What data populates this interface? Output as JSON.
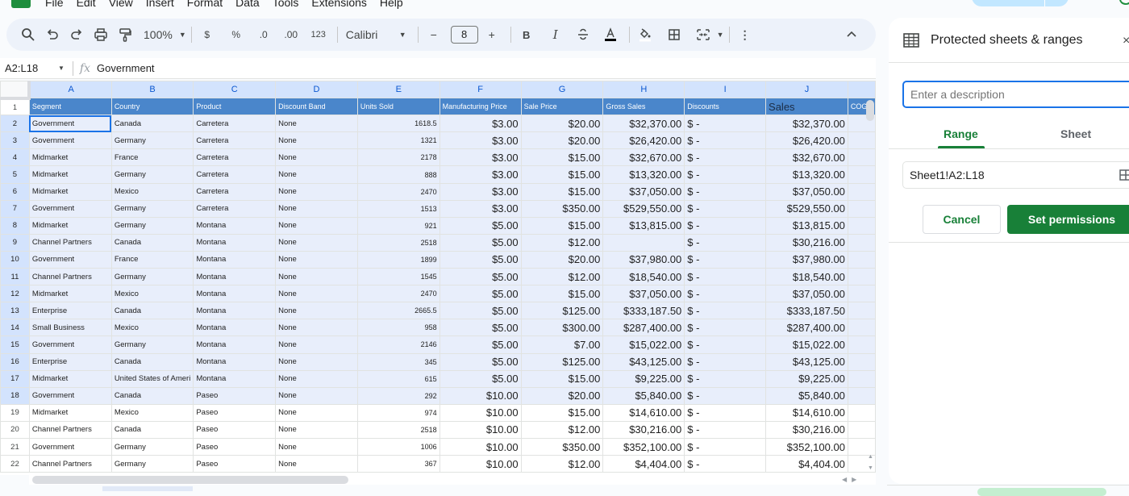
{
  "menubar": {
    "items": [
      "File",
      "Edit",
      "View",
      "Insert",
      "Format",
      "Data",
      "Tools",
      "Extensions",
      "Help"
    ]
  },
  "toolbar": {
    "zoom": "100%",
    "currency": "$",
    "percent": "%",
    "decrease_decimal": ".0",
    "increase_decimal": ".00",
    "number_format": "123",
    "font": "Calibri",
    "font_size": "8",
    "minus": "−",
    "plus": "+",
    "bold": "B",
    "italic": "I",
    "more": "⋮",
    "collapse": "^"
  },
  "formula_bar": {
    "name_box": "A2:L18",
    "fx": "fx",
    "formula": "Government"
  },
  "grid": {
    "columns": [
      "A",
      "B",
      "C",
      "D",
      "E",
      "F",
      "G",
      "H",
      "I",
      "J",
      ""
    ],
    "header_row": [
      "Segment",
      "Country",
      "Product",
      "Discount Band",
      "Units Sold",
      "Manufacturing Price",
      "Sale Price",
      "Gross Sales",
      "Discounts",
      "Sales",
      "COGS"
    ],
    "selected_rows_range": [
      2,
      18
    ],
    "rows": [
      {
        "n": "2",
        "cells": [
          "Government",
          "Canada",
          "Carretera",
          "None",
          "1618.5",
          "$3.00",
          "$20.00",
          "$32,370.00",
          "$ -",
          "$32,370.00"
        ]
      },
      {
        "n": "3",
        "cells": [
          "Government",
          "Germany",
          "Carretera",
          "None",
          "1321",
          "$3.00",
          "$20.00",
          "$26,420.00",
          "$ -",
          "$26,420.00"
        ]
      },
      {
        "n": "4",
        "cells": [
          "Midmarket",
          "France",
          "Carretera",
          "None",
          "2178",
          "$3.00",
          "$15.00",
          "$32,670.00",
          "$ -",
          "$32,670.00"
        ]
      },
      {
        "n": "5",
        "cells": [
          "Midmarket",
          "Germany",
          "Carretera",
          "None",
          "888",
          "$3.00",
          "$15.00",
          "$13,320.00",
          "$ -",
          "$13,320.00"
        ]
      },
      {
        "n": "6",
        "cells": [
          "Midmarket",
          "Mexico",
          "Carretera",
          "None",
          "2470",
          "$3.00",
          "$15.00",
          "$37,050.00",
          "$ -",
          "$37,050.00"
        ]
      },
      {
        "n": "7",
        "cells": [
          "Government",
          "Germany",
          "Carretera",
          "None",
          "1513",
          "$3.00",
          "$350.00",
          "$529,550.00",
          "$ -",
          "$529,550.00"
        ]
      },
      {
        "n": "8",
        "cells": [
          "Midmarket",
          "Germany",
          "Montana",
          "None",
          "921",
          "$5.00",
          "$15.00",
          "$13,815.00",
          "$ -",
          "$13,815.00"
        ]
      },
      {
        "n": "9",
        "cells": [
          "Channel Partners",
          "Canada",
          "Montana",
          "None",
          "2518",
          "$5.00",
          "$12.00",
          "",
          "$ -",
          "$30,216.00"
        ]
      },
      {
        "n": "10",
        "cells": [
          "Government",
          "France",
          "Montana",
          "None",
          "1899",
          "$5.00",
          "$20.00",
          "$37,980.00",
          "$ -",
          "$37,980.00"
        ]
      },
      {
        "n": "11",
        "cells": [
          "Channel Partners",
          "Germany",
          "Montana",
          "None",
          "1545",
          "$5.00",
          "$12.00",
          "$18,540.00",
          "$ -",
          "$18,540.00"
        ]
      },
      {
        "n": "12",
        "cells": [
          "Midmarket",
          "Mexico",
          "Montana",
          "None",
          "2470",
          "$5.00",
          "$15.00",
          "$37,050.00",
          "$ -",
          "$37,050.00"
        ]
      },
      {
        "n": "13",
        "cells": [
          "Enterprise",
          "Canada",
          "Montana",
          "None",
          "2665.5",
          "$5.00",
          "$125.00",
          "$333,187.50",
          "$ -",
          "$333,187.50"
        ]
      },
      {
        "n": "14",
        "cells": [
          "Small Business",
          "Mexico",
          "Montana",
          "None",
          "958",
          "$5.00",
          "$300.00",
          "$287,400.00",
          "$ -",
          "$287,400.00"
        ]
      },
      {
        "n": "15",
        "cells": [
          "Government",
          "Germany",
          "Montana",
          "None",
          "2146",
          "$5.00",
          "$7.00",
          "$15,022.00",
          "$ -",
          "$15,022.00"
        ]
      },
      {
        "n": "16",
        "cells": [
          "Enterprise",
          "Canada",
          "Montana",
          "None",
          "345",
          "$5.00",
          "$125.00",
          "$43,125.00",
          "$ -",
          "$43,125.00"
        ]
      },
      {
        "n": "17",
        "cells": [
          "Midmarket",
          "United States of Ameri",
          "Montana",
          "None",
          "615",
          "$5.00",
          "$15.00",
          "$9,225.00",
          "$ -",
          "$9,225.00"
        ]
      },
      {
        "n": "18",
        "cells": [
          "Government",
          "Canada",
          "Paseo",
          "None",
          "292",
          "$10.00",
          "$20.00",
          "$5,840.00",
          "$ -",
          "$5,840.00"
        ]
      },
      {
        "n": "19",
        "cells": [
          "Midmarket",
          "Mexico",
          "Paseo",
          "None",
          "974",
          "$10.00",
          "$15.00",
          "$14,610.00",
          "$ -",
          "$14,610.00"
        ]
      },
      {
        "n": "20",
        "cells": [
          "Channel Partners",
          "Canada",
          "Paseo",
          "None",
          "2518",
          "$10.00",
          "$12.00",
          "$30,216.00",
          "$ -",
          "$30,216.00"
        ]
      },
      {
        "n": "21",
        "cells": [
          "Government",
          "Germany",
          "Paseo",
          "None",
          "1006",
          "$10.00",
          "$350.00",
          "$352,100.00",
          "$ -",
          "$352,100.00"
        ]
      },
      {
        "n": "22",
        "cells": [
          "Channel Partners",
          "Germany",
          "Paseo",
          "None",
          "367",
          "$10.00",
          "$12.00",
          "$4,404.00",
          "$ -",
          "$4,404.00"
        ]
      }
    ]
  },
  "panel": {
    "title": "Protected sheets & ranges",
    "close": "×",
    "description_placeholder": "Enter a description",
    "description_value": "",
    "tabs": [
      "Range",
      "Sheet"
    ],
    "active_tab": "Range",
    "range_value": "Sheet1!A2:L18",
    "cancel_label": "Cancel",
    "set_permissions_label": "Set permissions"
  },
  "colors": {
    "accent_green": "#188038",
    "header_blue": "#4a86cb",
    "selection_fill": "#e8eefb",
    "focus_blue": "#1a73e8"
  }
}
